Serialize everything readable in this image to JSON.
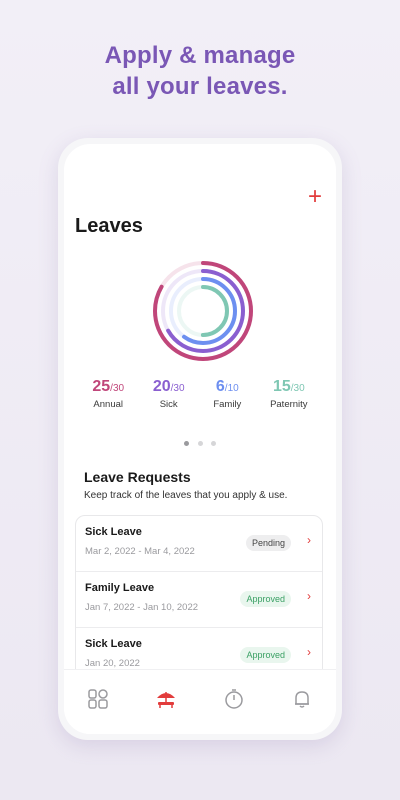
{
  "headline": {
    "line1": "Apply & manage",
    "line2": "all your leaves."
  },
  "screen": {
    "title": "Leaves",
    "add_icon": "plus-icon",
    "colors": {
      "accent": "#e23c3c",
      "headline": "#7a57b5"
    },
    "stats": [
      {
        "value": "25",
        "total": "/30",
        "label": "Annual",
        "color": "#c0467a",
        "fraction": 0.833
      },
      {
        "value": "20",
        "total": "/30",
        "label": "Sick",
        "color": "#8a5fd0",
        "fraction": 0.667
      },
      {
        "value": "6",
        "total": "/10",
        "label": "Family",
        "color": "#6d8ff0",
        "fraction": 0.6
      },
      {
        "value": "15",
        "total": "/30",
        "label": "Paternity",
        "color": "#7fc7b3",
        "fraction": 0.5
      }
    ],
    "pager": {
      "count": 3,
      "active": 1
    },
    "requests": {
      "title": "Leave Requests",
      "subtitle": "Keep track of the leaves that you apply & use.",
      "items": [
        {
          "name": "Sick Leave",
          "date": "Mar 2, 2022 - Mar 4, 2022",
          "status": "Pending",
          "status_type": "pending"
        },
        {
          "name": "Family Leave",
          "date": "Jan 7, 2022 - Jan 10, 2022",
          "status": "Approved",
          "status_type": "approved"
        },
        {
          "name": "Sick Leave",
          "date": "Jan 20, 2022",
          "status": "Approved",
          "status_type": "approved"
        }
      ]
    },
    "tabbar": {
      "items": [
        {
          "icon": "dashboard-icon",
          "active": false
        },
        {
          "icon": "beach-umbrella-icon",
          "active": true
        },
        {
          "icon": "stopwatch-icon",
          "active": false
        },
        {
          "icon": "bell-icon",
          "active": false
        }
      ]
    }
  }
}
